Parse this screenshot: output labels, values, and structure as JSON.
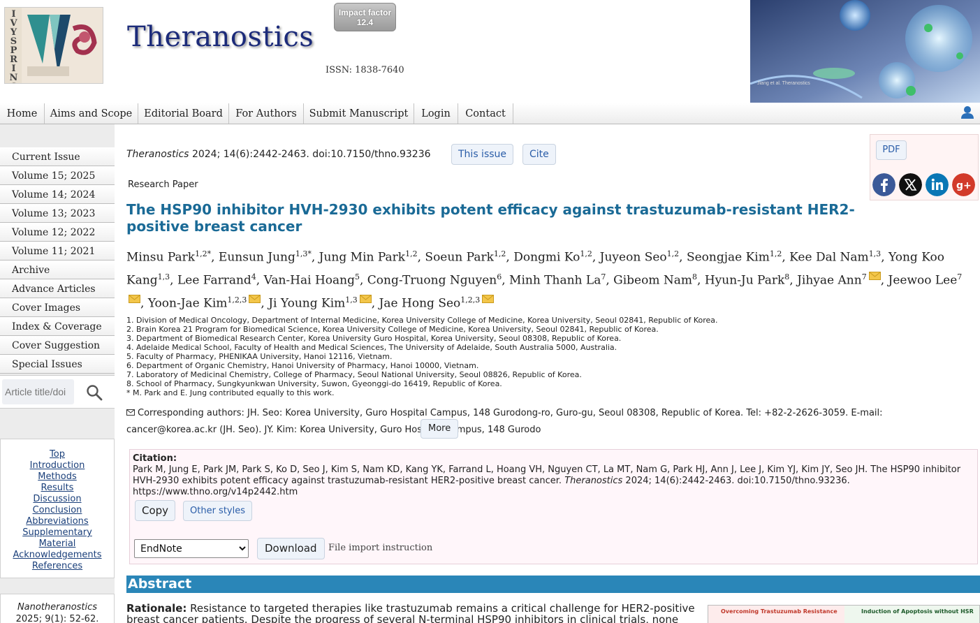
{
  "header": {
    "logo_letters": "IVYSPRING",
    "journal_name": "Theranostics",
    "impact_label": "Impact factor",
    "impact_value": "12.4",
    "issn": "ISSN: 1838-7640",
    "cover_caption": "Jiang et al. Theranostics"
  },
  "nav": {
    "items": [
      "Home",
      "Aims and Scope",
      "Editorial Board",
      "For Authors",
      "Submit Manuscript",
      "Login",
      "Contact"
    ]
  },
  "sidebar": {
    "items": [
      "Current Issue",
      "Volume 15; 2025",
      "Volume 14; 2024",
      "Volume 13; 2023",
      "Volume 12; 2022",
      "Volume 11; 2021",
      "Archive",
      "Advance Articles",
      "Cover Images",
      "Index & Coverage",
      "Cover Suggestion",
      "Special Issues"
    ],
    "search_placeholder": "Article title/doi"
  },
  "toc": [
    "Top",
    "Introduction",
    "Methods",
    "Results",
    "Discussion",
    "Conclusion",
    "Abbreviations",
    "Supplementary Material",
    "Acknowledgements",
    "References"
  ],
  "related": {
    "journal": "Nanotheranostics",
    "ref": "2025; 9(1): 52-62."
  },
  "article": {
    "journal_italic": "Theranostics",
    "citation_ref": "2024; 14(6):2442-2463. doi:10.7150/thno.93236",
    "this_issue_label": "This issue",
    "cite_label": "Cite",
    "type": "Research Paper",
    "title": "The HSP90 inhibitor HVH-2930 exhibits potent efficacy against trastuzumab-resistant HER2-positive breast cancer",
    "authors": [
      {
        "name": "Minsu Park",
        "sup": "1,2*"
      },
      {
        "name": "Eunsun Jung",
        "sup": "1,3*"
      },
      {
        "name": "Jung Min Park",
        "sup": "1,2"
      },
      {
        "name": "Soeun Park",
        "sup": "1,2"
      },
      {
        "name": "Dongmi Ko",
        "sup": "1,2"
      },
      {
        "name": "Juyeon Seo",
        "sup": "1,2"
      },
      {
        "name": "Seongjae Kim",
        "sup": "1,2"
      },
      {
        "name": "Kee Dal Nam",
        "sup": "1,3"
      },
      {
        "name": "Yong Koo Kang",
        "sup": "1,3"
      },
      {
        "name": "Lee Farrand",
        "sup": "4"
      },
      {
        "name": "Van-Hai Hoang",
        "sup": "5"
      },
      {
        "name": "Cong-Truong Nguyen",
        "sup": "6"
      },
      {
        "name": "Minh Thanh La",
        "sup": "7"
      },
      {
        "name": "Gibeom Nam",
        "sup": "8"
      },
      {
        "name": "Hyun-Ju Park",
        "sup": "8"
      },
      {
        "name": "Jihyae Ann",
        "sup": "7",
        "mail": true
      },
      {
        "name": "Jeewoo Lee",
        "sup": "7",
        "mail": true
      },
      {
        "name": "Yoon-Jae Kim",
        "sup": "1,2,3",
        "mail": true
      },
      {
        "name": "Ji Young Kim",
        "sup": "1,3",
        "mail": true
      },
      {
        "name": "Jae Hong Seo",
        "sup": "1,2,3",
        "mail": true
      }
    ],
    "affiliations": [
      "1. Division of Medical Oncology, Department of Internal Medicine, Korea University College of Medicine, Korea University, Seoul 02841, Republic of Korea.",
      "2. Brain Korea 21 Program for Biomedical Science, Korea University College of Medicine, Korea University, Seoul 02841, Republic of Korea.",
      "3. Department of Biomedical Research Center, Korea University Guro Hospital, Korea University, Seoul 08308, Republic of Korea.",
      "4. Adelaide Medical School, Faculty of Health and Medical Sciences, The University of Adelaide, South Australia 5000, Australia.",
      "5. Faculty of Pharmacy, PHENIKAA University, Hanoi 12116, Vietnam.",
      "6. Department of Organic Chemistry, Hanoi University of Pharmacy, Hanoi 10000, Vietnam.",
      "7. Laboratory of Medicinal Chemistry, College of Pharmacy, Seoul National University, Seoul 08826, Republic of Korea.",
      "8. School of Pharmacy, Sungkyunkwan University, Suwon, Gyeonggi-do 16419, Republic of Korea.",
      "* M. Park and E. Jung contributed equally to this work."
    ],
    "corresponding": "Corresponding authors: JH. Seo: Korea University, Guro Hospital Campus, 148 Gurodong-ro, Guro-gu, Seoul 08308, Republic of Korea. Tel: +82-2-2626-3059. E-mail: cancer@korea.ac.kr (JH. Seo). JY. Kim: Korea University, Guro Hospital Campus, 148 Gurodo",
    "more_label": "More"
  },
  "share": {
    "pdf_label": "PDF",
    "icons": [
      "facebook-icon",
      "x-icon",
      "linkedin-icon",
      "google-plus-icon"
    ]
  },
  "citation": {
    "label": "Citation:",
    "text_before": "Park M, Jung E, Park JM, Park S, Ko D, Seo J, Kim S, Nam KD, Kang YK, Farrand L, Hoang VH, Nguyen CT, La MT, Nam G, Park HJ, Ann J, Lee J, Kim YJ, Kim JY, Seo JH. The HSP90 inhibitor HVH-2930 exhibits potent efficacy against trastuzumab-resistant HER2-positive breast cancer. ",
    "journal": "Theranostics",
    "text_after": " 2024; 14(6):2442-2463. doi:10.7150/thno.93236. https://www.thno.org/v14p2442.htm",
    "copy_label": "Copy",
    "other_styles_label": "Other styles",
    "format_selected": "EndNote",
    "download_label": "Download",
    "import_label": "File import instruction"
  },
  "abstract": {
    "heading": "Abstract",
    "rationale_label": "Rationale:",
    "rationale_text": " Resistance to targeted therapies like trastuzumab remains a critical challenge for HER2-positive breast cancer patients. Despite the progress of several N-terminal HSP90 inhibitors in clinical trials, none have achieved",
    "graphic_left": "Overcoming Trastuzumab Resistance",
    "graphic_right": "Induction of Apoptosis without HSR"
  },
  "colors": {
    "title_blue": "#1a6a96",
    "abstract_bar": "#2a86b8",
    "link_blue": "#2a5da8"
  }
}
